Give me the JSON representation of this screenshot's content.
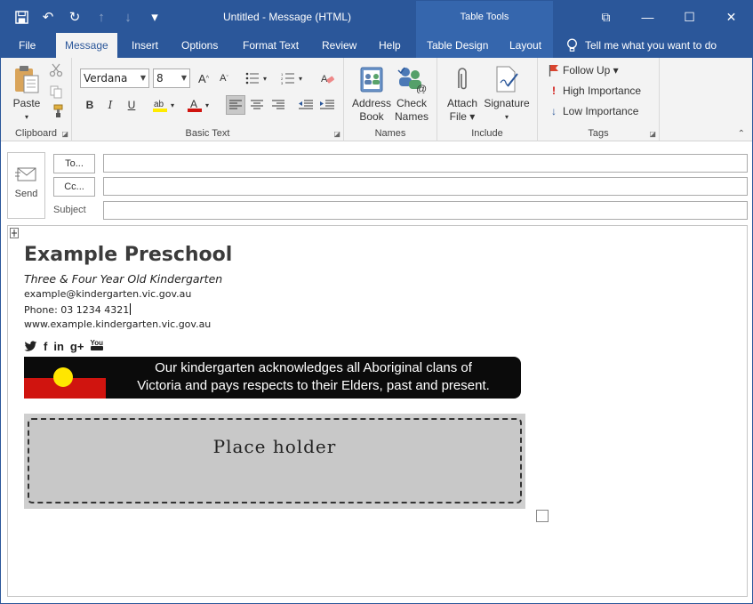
{
  "window": {
    "title": "Untitled  -  Message (HTML)",
    "contextual_group": "Table Tools",
    "restore_glyph": "⧉",
    "minimize_glyph": "—",
    "maximize_glyph": "☐",
    "close_glyph": "✕"
  },
  "qat": {
    "save_glyph": "💾",
    "undo_glyph": "↶",
    "redo_glyph": "↻",
    "up_glyph": "↑",
    "down_glyph": "↓",
    "customize_glyph": "▾"
  },
  "tabs": [
    "File",
    "Message",
    "Insert",
    "Options",
    "Format Text",
    "Review",
    "Help",
    "Table Design",
    "Layout"
  ],
  "active_tab": "Message",
  "tell_me": "Tell me what you want to do",
  "ribbon": {
    "clipboard": {
      "label": "Clipboard",
      "paste": "Paste"
    },
    "basic_text": {
      "label": "Basic Text",
      "font": "Verdana",
      "size": "8",
      "bold": "B",
      "italic": "I",
      "underline": "U",
      "grow": "A",
      "shrink": "A"
    },
    "names": {
      "label": "Names",
      "address_book_1": "Address",
      "address_book_2": "Book",
      "check_names_1": "Check",
      "check_names_2": "Names"
    },
    "include": {
      "label": "Include",
      "attach_1": "Attach",
      "attach_2": "File ▾",
      "signature_1": "Signature",
      "signature_2": "▾"
    },
    "tags": {
      "label": "Tags",
      "follow_up": "Follow Up ▾",
      "high": "High Importance",
      "low": "Low Importance"
    }
  },
  "compose": {
    "send": "Send",
    "to_label": "To...",
    "cc_label": "Cc...",
    "subject_label": "Subject",
    "to_value": "",
    "cc_value": "",
    "subject_value": ""
  },
  "signature": {
    "name": "Example Preschool",
    "subtitle": "Three & Four Year Old Kindergarten",
    "email": "example@kindergarten.vic.gov.au",
    "phone": "Phone: 03 1234 4321",
    "website": "www.example.kindergarten.vic.gov.au",
    "social": [
      "twitter-icon",
      "facebook-icon",
      "linkedin-icon",
      "googleplus-icon",
      "youtube-icon"
    ],
    "social_glyphs": {
      "twitter": "🐦",
      "facebook": "f",
      "linkedin": "in",
      "googleplus": "g+",
      "youtube": "You"
    },
    "acknowledgement_line1": "Our kindergarten acknowledges all Aboriginal clans of",
    "acknowledgement_line2": "Victoria and pays respects to their Elders, past and present.",
    "placeholder": "Place holder"
  },
  "colors": {
    "accent": "#2b579a",
    "flag_red": "#d0140f",
    "flag_yellow": "#ffe600",
    "banner_bg": "#0b0b0b"
  }
}
